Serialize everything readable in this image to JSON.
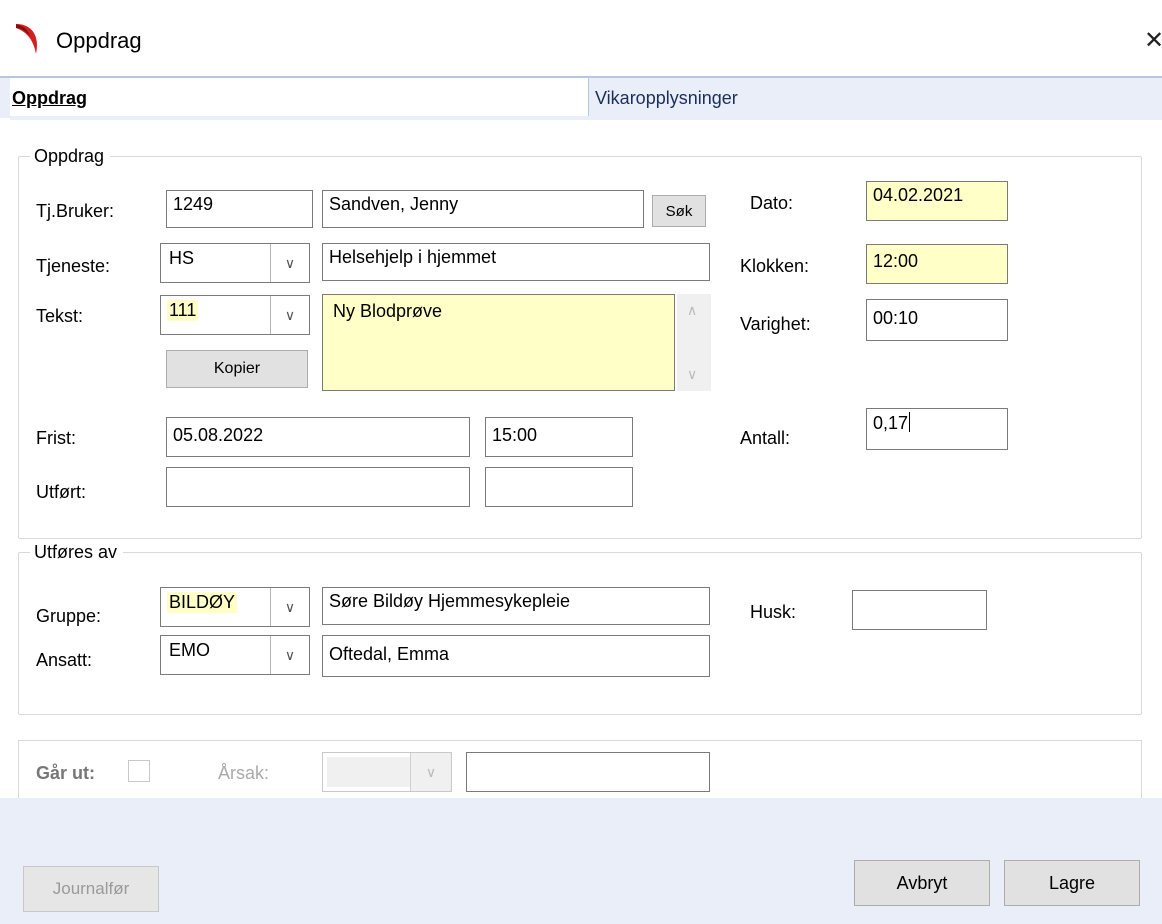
{
  "window": {
    "title": "Oppdrag",
    "close_glyph": "✕",
    "app_icon": "red-crescent-logo-icon"
  },
  "tabs": [
    {
      "label": "Oppdrag",
      "active": true
    },
    {
      "label": "Vikaropplysninger",
      "active": false
    }
  ],
  "oppdrag_section": {
    "legend": "Oppdrag",
    "tj_bruker": {
      "label": "Tj.Bruker:",
      "id": "1249",
      "name": "Sandven, Jenny",
      "search_button": "Søk"
    },
    "tjeneste": {
      "label": "Tjeneste:",
      "code": "HS",
      "description": "Helsehjelp i hjemmet"
    },
    "tekst": {
      "label": "Tekst:",
      "code": "111",
      "text": "Ny Blodprøve",
      "copy_button": "Kopier"
    },
    "frist": {
      "label": "Frist:",
      "date": "05.08.2022",
      "time": "15:00"
    },
    "utfort": {
      "label": "Utført:",
      "date": "",
      "time": ""
    },
    "dato": {
      "label": "Dato:",
      "value": "04.02.2021"
    },
    "klokken": {
      "label": "Klokken:",
      "value": "12:00"
    },
    "varighet": {
      "label": "Varighet:",
      "value": "00:10"
    },
    "antall": {
      "label": "Antall:",
      "value": "0,17"
    }
  },
  "utfores_section": {
    "legend": "Utføres av",
    "gruppe": {
      "label": "Gruppe:",
      "code": "BILDØY",
      "name": "Søre Bildøy Hjemmesykepleie"
    },
    "ansatt": {
      "label": "Ansatt:",
      "code": "EMO",
      "name": "Oftedal, Emma"
    },
    "husk": {
      "label": "Husk:",
      "value": ""
    }
  },
  "gar_ut": {
    "label": "Går ut:",
    "checked": false,
    "arsak_label": "Årsak:",
    "arsak_value": "",
    "text": ""
  },
  "footer": {
    "journalfor": "Journalfør",
    "avbryt": "Avbryt",
    "lagre": "Lagre"
  },
  "colors": {
    "tab_bar": "#e9eef8",
    "tab_inactive": "#e9eef8",
    "footer_bg": "#e9eef8",
    "highlight_field": "#ffffc8",
    "brand_red": "#d22020"
  }
}
